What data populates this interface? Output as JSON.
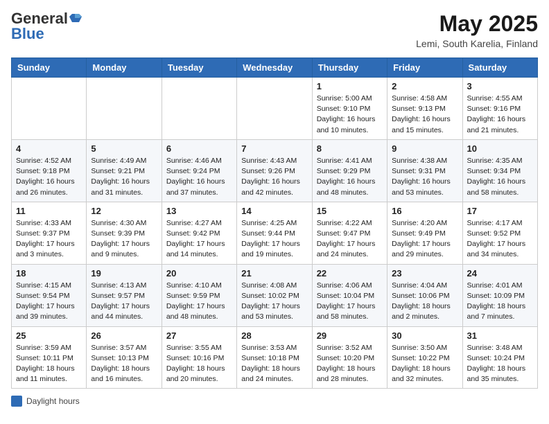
{
  "header": {
    "logo_general": "General",
    "logo_blue": "Blue",
    "month": "May 2025",
    "location": "Lemi, South Karelia, Finland"
  },
  "weekdays": [
    "Sunday",
    "Monday",
    "Tuesday",
    "Wednesday",
    "Thursday",
    "Friday",
    "Saturday"
  ],
  "weeks": [
    [
      {
        "day": "",
        "info": ""
      },
      {
        "day": "",
        "info": ""
      },
      {
        "day": "",
        "info": ""
      },
      {
        "day": "",
        "info": ""
      },
      {
        "day": "1",
        "info": "Sunrise: 5:00 AM\nSunset: 9:10 PM\nDaylight: 16 hours\nand 10 minutes."
      },
      {
        "day": "2",
        "info": "Sunrise: 4:58 AM\nSunset: 9:13 PM\nDaylight: 16 hours\nand 15 minutes."
      },
      {
        "day": "3",
        "info": "Sunrise: 4:55 AM\nSunset: 9:16 PM\nDaylight: 16 hours\nand 21 minutes."
      }
    ],
    [
      {
        "day": "4",
        "info": "Sunrise: 4:52 AM\nSunset: 9:18 PM\nDaylight: 16 hours\nand 26 minutes."
      },
      {
        "day": "5",
        "info": "Sunrise: 4:49 AM\nSunset: 9:21 PM\nDaylight: 16 hours\nand 31 minutes."
      },
      {
        "day": "6",
        "info": "Sunrise: 4:46 AM\nSunset: 9:24 PM\nDaylight: 16 hours\nand 37 minutes."
      },
      {
        "day": "7",
        "info": "Sunrise: 4:43 AM\nSunset: 9:26 PM\nDaylight: 16 hours\nand 42 minutes."
      },
      {
        "day": "8",
        "info": "Sunrise: 4:41 AM\nSunset: 9:29 PM\nDaylight: 16 hours\nand 48 minutes."
      },
      {
        "day": "9",
        "info": "Sunrise: 4:38 AM\nSunset: 9:31 PM\nDaylight: 16 hours\nand 53 minutes."
      },
      {
        "day": "10",
        "info": "Sunrise: 4:35 AM\nSunset: 9:34 PM\nDaylight: 16 hours\nand 58 minutes."
      }
    ],
    [
      {
        "day": "11",
        "info": "Sunrise: 4:33 AM\nSunset: 9:37 PM\nDaylight: 17 hours\nand 3 minutes."
      },
      {
        "day": "12",
        "info": "Sunrise: 4:30 AM\nSunset: 9:39 PM\nDaylight: 17 hours\nand 9 minutes."
      },
      {
        "day": "13",
        "info": "Sunrise: 4:27 AM\nSunset: 9:42 PM\nDaylight: 17 hours\nand 14 minutes."
      },
      {
        "day": "14",
        "info": "Sunrise: 4:25 AM\nSunset: 9:44 PM\nDaylight: 17 hours\nand 19 minutes."
      },
      {
        "day": "15",
        "info": "Sunrise: 4:22 AM\nSunset: 9:47 PM\nDaylight: 17 hours\nand 24 minutes."
      },
      {
        "day": "16",
        "info": "Sunrise: 4:20 AM\nSunset: 9:49 PM\nDaylight: 17 hours\nand 29 minutes."
      },
      {
        "day": "17",
        "info": "Sunrise: 4:17 AM\nSunset: 9:52 PM\nDaylight: 17 hours\nand 34 minutes."
      }
    ],
    [
      {
        "day": "18",
        "info": "Sunrise: 4:15 AM\nSunset: 9:54 PM\nDaylight: 17 hours\nand 39 minutes."
      },
      {
        "day": "19",
        "info": "Sunrise: 4:13 AM\nSunset: 9:57 PM\nDaylight: 17 hours\nand 44 minutes."
      },
      {
        "day": "20",
        "info": "Sunrise: 4:10 AM\nSunset: 9:59 PM\nDaylight: 17 hours\nand 48 minutes."
      },
      {
        "day": "21",
        "info": "Sunrise: 4:08 AM\nSunset: 10:02 PM\nDaylight: 17 hours\nand 53 minutes."
      },
      {
        "day": "22",
        "info": "Sunrise: 4:06 AM\nSunset: 10:04 PM\nDaylight: 17 hours\nand 58 minutes."
      },
      {
        "day": "23",
        "info": "Sunrise: 4:04 AM\nSunset: 10:06 PM\nDaylight: 18 hours\nand 2 minutes."
      },
      {
        "day": "24",
        "info": "Sunrise: 4:01 AM\nSunset: 10:09 PM\nDaylight: 18 hours\nand 7 minutes."
      }
    ],
    [
      {
        "day": "25",
        "info": "Sunrise: 3:59 AM\nSunset: 10:11 PM\nDaylight: 18 hours\nand 11 minutes."
      },
      {
        "day": "26",
        "info": "Sunrise: 3:57 AM\nSunset: 10:13 PM\nDaylight: 18 hours\nand 16 minutes."
      },
      {
        "day": "27",
        "info": "Sunrise: 3:55 AM\nSunset: 10:16 PM\nDaylight: 18 hours\nand 20 minutes."
      },
      {
        "day": "28",
        "info": "Sunrise: 3:53 AM\nSunset: 10:18 PM\nDaylight: 18 hours\nand 24 minutes."
      },
      {
        "day": "29",
        "info": "Sunrise: 3:52 AM\nSunset: 10:20 PM\nDaylight: 18 hours\nand 28 minutes."
      },
      {
        "day": "30",
        "info": "Sunrise: 3:50 AM\nSunset: 10:22 PM\nDaylight: 18 hours\nand 32 minutes."
      },
      {
        "day": "31",
        "info": "Sunrise: 3:48 AM\nSunset: 10:24 PM\nDaylight: 18 hours\nand 35 minutes."
      }
    ]
  ],
  "footer": {
    "legend_label": "Daylight hours"
  }
}
